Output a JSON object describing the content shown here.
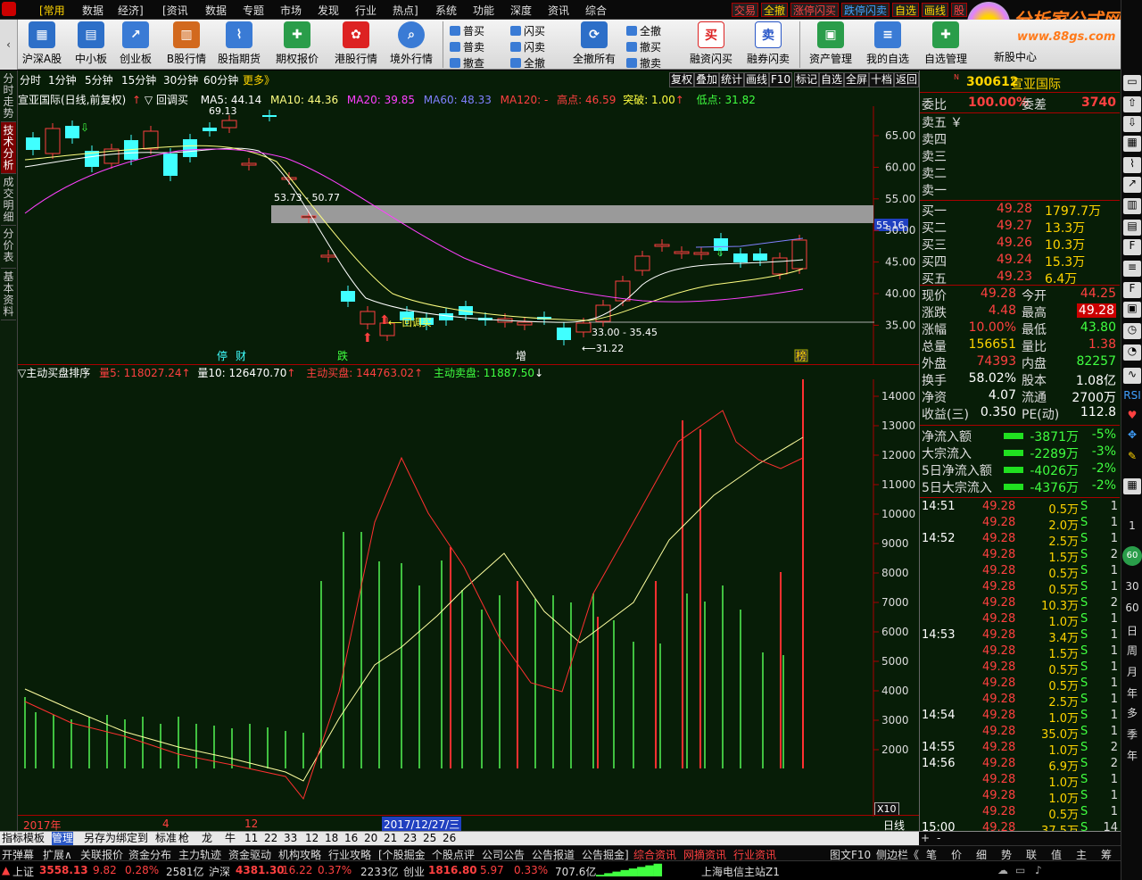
{
  "menubar": {
    "items": [
      "[常用",
      "数据",
      "经济]",
      "[资讯",
      "数据",
      "专题",
      "市场",
      "发现",
      "行业",
      "热点]",
      "系统",
      "功能",
      "深度",
      "资讯",
      "综合"
    ],
    "red_buttons": [
      "交易",
      "全撤",
      "涨停闪买",
      "跌停闪卖",
      "自选",
      "画线",
      "股"
    ],
    "logo_title": "分析家公式网",
    "logo_url": "www.88gs.com"
  },
  "toolbar": {
    "big": [
      "沪深A股",
      "中小板",
      "创业板",
      "B股行情",
      "股指期货",
      "期权报价",
      "港股行情",
      "境外行情"
    ],
    "small_col1": [
      "普买",
      "普卖",
      "撤查"
    ],
    "small_col2": [
      "闪买",
      "闪卖",
      "全撤"
    ],
    "mid": "全撤所有",
    "small_col3": [
      "全撤",
      "撤买",
      "撤卖"
    ],
    "big2": [
      "融资闪买",
      "融券闪卖",
      "资产管理",
      "我的自选",
      "自选管理",
      "新股中心"
    ]
  },
  "left_tabs": [
    "分时走势",
    "技术分析",
    "成交明细",
    "分价表",
    "基本资料"
  ],
  "periods": [
    "分时",
    "1分钟",
    "5分钟",
    "15分钟",
    "30分钟",
    "60分钟",
    "更多》"
  ],
  "chart_tools": [
    "复权",
    "叠加",
    "统计",
    "画线",
    "F10",
    "标记",
    "自选",
    "全屏",
    "十档",
    "返回"
  ],
  "main_header": {
    "name": "宣亚国际(日线,前复权)",
    "indicator": "回调买",
    "ma5": "MA5: 44.14",
    "ma10": "MA10: 44.36",
    "ma20": "MA20: 39.85",
    "ma60": "MA60: 48.33",
    "ma120": "MA120: -",
    "high": "高点: 46.59",
    "breakout": "突破: 1.00",
    "low": "低点: 31.82"
  },
  "main_annotations": {
    "peak": "69.13",
    "zone": "53.73 - 50.77",
    "bottom": "33.00 - 35.45",
    "low": "31.22",
    "callback": "回调买",
    "price_tag": "55.16"
  },
  "event_labels": [
    "停",
    "财",
    "跌",
    "增",
    "榜"
  ],
  "y_axis_main": [
    "65.00",
    "60.00",
    "55.00",
    "50.00",
    "45.00",
    "40.00",
    "35.00"
  ],
  "sub_header": {
    "name": "主动买盘排序",
    "v5": "量5: 118027.24",
    "v10": "量10: 126470.70",
    "buy": "主动买盘: 144763.02",
    "sell": "主动卖盘: 11887.50"
  },
  "y_axis_sub": [
    "14000",
    "13000",
    "12000",
    "11000",
    "10000",
    "9000",
    "8000",
    "7000",
    "6000",
    "5000",
    "4000",
    "3000",
    "2000"
  ],
  "x_axis": [
    "2017年",
    "4",
    "12"
  ],
  "x_date": "2017/12/27/三",
  "x10": "X10",
  "period_label": "日线",
  "quote": {
    "code": "300612",
    "name": "宣亚国际",
    "wb": "100.00%",
    "wc": "3740",
    "asks": [
      "卖五",
      "卖四",
      "卖三",
      "卖二",
      "卖一"
    ],
    "bids": [
      [
        "买一",
        "49.28",
        "1797.7万"
      ],
      [
        "买二",
        "49.27",
        "13.3万"
      ],
      [
        "买三",
        "49.26",
        "10.3万"
      ],
      [
        "买四",
        "49.24",
        "15.3万"
      ],
      [
        "买五",
        "49.23",
        "6.4万"
      ]
    ],
    "stats": [
      [
        "现价",
        "49.28",
        "今开",
        "44.25"
      ],
      [
        "涨跌",
        "4.48",
        "最高",
        "49.28"
      ],
      [
        "涨幅",
        "10.00%",
        "最低",
        "43.80"
      ],
      [
        "总量",
        "156651",
        "量比",
        "1.38"
      ],
      [
        "外盘",
        "74393",
        "内盘",
        "82257"
      ],
      [
        "换手",
        "58.02%",
        "股本",
        "1.08亿"
      ],
      [
        "净资",
        "4.07",
        "流通",
        "2700万"
      ],
      [
        "收益(三)",
        "0.350",
        "PE(动)",
        "112.8"
      ]
    ],
    "flows": [
      [
        "净流入额",
        "-3871万",
        "-5%"
      ],
      [
        "大宗流入",
        "-2289万",
        "-3%"
      ],
      [
        "5日净流入额",
        "-4026万",
        "-2%"
      ],
      [
        "5日大宗流入",
        "-4376万",
        "-2%"
      ]
    ],
    "ticks": [
      [
        "14:51",
        "49.28",
        "0.5万",
        "S",
        "1"
      ],
      [
        "",
        "49.28",
        "2.0万",
        "S",
        "1"
      ],
      [
        "14:52",
        "49.28",
        "2.5万",
        "S",
        "1"
      ],
      [
        "",
        "49.28",
        "1.5万",
        "S",
        "2"
      ],
      [
        "",
        "49.28",
        "0.5万",
        "S",
        "1"
      ],
      [
        "",
        "49.28",
        "0.5万",
        "S",
        "1"
      ],
      [
        "",
        "49.28",
        "10.3万",
        "S",
        "2"
      ],
      [
        "",
        "49.28",
        "1.0万",
        "S",
        "1"
      ],
      [
        "14:53",
        "49.28",
        "3.4万",
        "S",
        "1"
      ],
      [
        "",
        "49.28",
        "1.5万",
        "S",
        "1"
      ],
      [
        "",
        "49.28",
        "0.5万",
        "S",
        "1"
      ],
      [
        "",
        "49.28",
        "0.5万",
        "S",
        "1"
      ],
      [
        "",
        "49.28",
        "2.5万",
        "S",
        "1"
      ],
      [
        "14:54",
        "49.28",
        "1.0万",
        "S",
        "1"
      ],
      [
        "",
        "49.28",
        "35.0万",
        "S",
        "1"
      ],
      [
        "14:55",
        "49.28",
        "1.0万",
        "S",
        "2"
      ],
      [
        "14:56",
        "49.28",
        "6.9万",
        "S",
        "2"
      ],
      [
        "",
        "49.28",
        "1.0万",
        "S",
        "1"
      ],
      [
        "",
        "49.28",
        "1.0万",
        "S",
        "1"
      ],
      [
        "",
        "49.28",
        "0.5万",
        "S",
        "1"
      ],
      [
        "15:00",
        "49.28",
        "37.5万",
        "S",
        "14"
      ]
    ]
  },
  "bottom_tabs": [
    "指标",
    "模板",
    "管理",
    "另存为",
    "绑定到",
    "标准",
    "枪",
    "龙",
    "牛",
    "11",
    "22",
    "33",
    "12",
    "18",
    "16",
    "20",
    "21",
    "23",
    "25",
    "26"
  ],
  "bottom_tabs2": [
    "开弹幕",
    "扩展∧",
    "关联报价",
    "资金分布",
    "主力轨迹",
    "资金驱动",
    "机构攻略",
    "行业攻略",
    "[个股掘金",
    "个股点评",
    "公司公告",
    "公告报道",
    "公告掘金]",
    "综合资讯",
    "网摘资讯",
    "行业资讯"
  ],
  "bottom_right": [
    "图文F10",
    "侧边栏《"
  ],
  "right_bottom_tabs": [
    "笔",
    "价",
    "细",
    "势",
    "联",
    "值",
    "主",
    "筹"
  ],
  "status": {
    "sh_label": "上证",
    "sh": "3558.13",
    "sh_chg": "9.82",
    "sh_pct": "0.28%",
    "sh_amt": "2581亿",
    "sz_label": "沪深",
    "sz": "4381.30",
    "sz_chg": "16.22",
    "sz_pct": "0.37%",
    "sz_amt": "2233亿",
    "cy_label": "创业",
    "cy": "1816.80",
    "cy_chg": "5.97",
    "cy_pct": "0.33%",
    "cy_amt": "707.6亿",
    "server": "上海电信主站Z1"
  },
  "right_strip": [
    "1",
    "30",
    "60",
    "日",
    "周",
    "月",
    "年",
    "多",
    "季",
    "年"
  ]
}
